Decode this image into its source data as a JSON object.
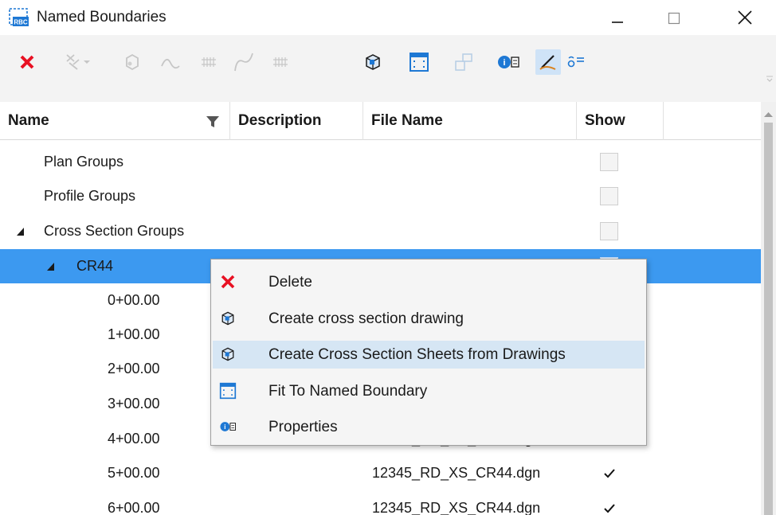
{
  "window": {
    "title": "Named Boundaries",
    "app_icon": "named-boundaries-icon",
    "controls": [
      "minimize",
      "maximize",
      "close"
    ]
  },
  "toolbar": {
    "buttons": [
      {
        "name": "delete",
        "icon": "red-x-icon",
        "enabled": true
      },
      {
        "name": "create",
        "icon": "boundary-create-icon",
        "enabled": false
      },
      {
        "name": "3d-model",
        "icon": "model-icon",
        "enabled": false
      },
      {
        "name": "profile",
        "icon": "profile-icon",
        "enabled": false
      },
      {
        "name": "grid",
        "icon": "grid-icon",
        "enabled": false
      },
      {
        "name": "curve",
        "icon": "curve-icon",
        "enabled": false
      },
      {
        "name": "grid2",
        "icon": "grid-icon",
        "enabled": false
      },
      {
        "name": "create-drawing",
        "icon": "cube-drawing-icon",
        "enabled": true
      },
      {
        "name": "fit",
        "icon": "fit-boundary-icon",
        "enabled": true
      },
      {
        "name": "sheets",
        "icon": "sheets-icon",
        "enabled": false
      },
      {
        "name": "properties",
        "icon": "properties-icon",
        "enabled": true
      },
      {
        "name": "draw",
        "icon": "pencil-draw-icon",
        "enabled": true,
        "active": true
      },
      {
        "name": "settings",
        "icon": "settings-list-icon",
        "enabled": true
      }
    ]
  },
  "columns": {
    "name": "Name",
    "description": "Description",
    "file_name": "File Name",
    "show": "Show"
  },
  "rows": [
    {
      "name": "Plan Groups",
      "file": "",
      "level": 1,
      "show": false
    },
    {
      "name": "Profile Groups",
      "file": "",
      "level": 1,
      "show": false
    },
    {
      "name": "Cross Section Groups",
      "file": "",
      "level": 1,
      "show": false,
      "expanded": true
    },
    {
      "name": "CR44",
      "file": "",
      "level": 2,
      "show": false,
      "expanded": true,
      "selected": true
    },
    {
      "name": "0+00.00",
      "file": "",
      "level": 3,
      "show": true
    },
    {
      "name": "1+00.00",
      "file": "",
      "level": 3,
      "show": true
    },
    {
      "name": "2+00.00",
      "file": "",
      "level": 3,
      "show": true
    },
    {
      "name": "3+00.00",
      "file": "",
      "level": 3,
      "show": true
    },
    {
      "name": "4+00.00",
      "file": "12345_RD_XS_CR44.dgn",
      "level": 3,
      "show": true
    },
    {
      "name": "5+00.00",
      "file": "12345_RD_XS_CR44.dgn",
      "level": 3,
      "show": true
    },
    {
      "name": "6+00.00",
      "file": "12345_RD_XS_CR44.dgn",
      "level": 3,
      "show": true
    }
  ],
  "context_menu": {
    "items": [
      {
        "label": "Delete",
        "icon": "red-x-icon"
      },
      {
        "label": "Create cross section drawing",
        "icon": "cube-drawing-icon"
      },
      {
        "label": "Create Cross Section Sheets from Drawings",
        "icon": "cube-sheets-icon",
        "hover": true
      },
      {
        "label": "Fit To Named Boundary",
        "icon": "fit-boundary-icon"
      },
      {
        "label": "Properties",
        "icon": "properties-icon"
      }
    ]
  },
  "colors": {
    "selection": "#3c99f0",
    "menu_hover": "#d6e6f4",
    "toolbar_bg": "#f3f3f3",
    "delete_red": "#e81123",
    "icon_blue": "#1e78d4"
  }
}
